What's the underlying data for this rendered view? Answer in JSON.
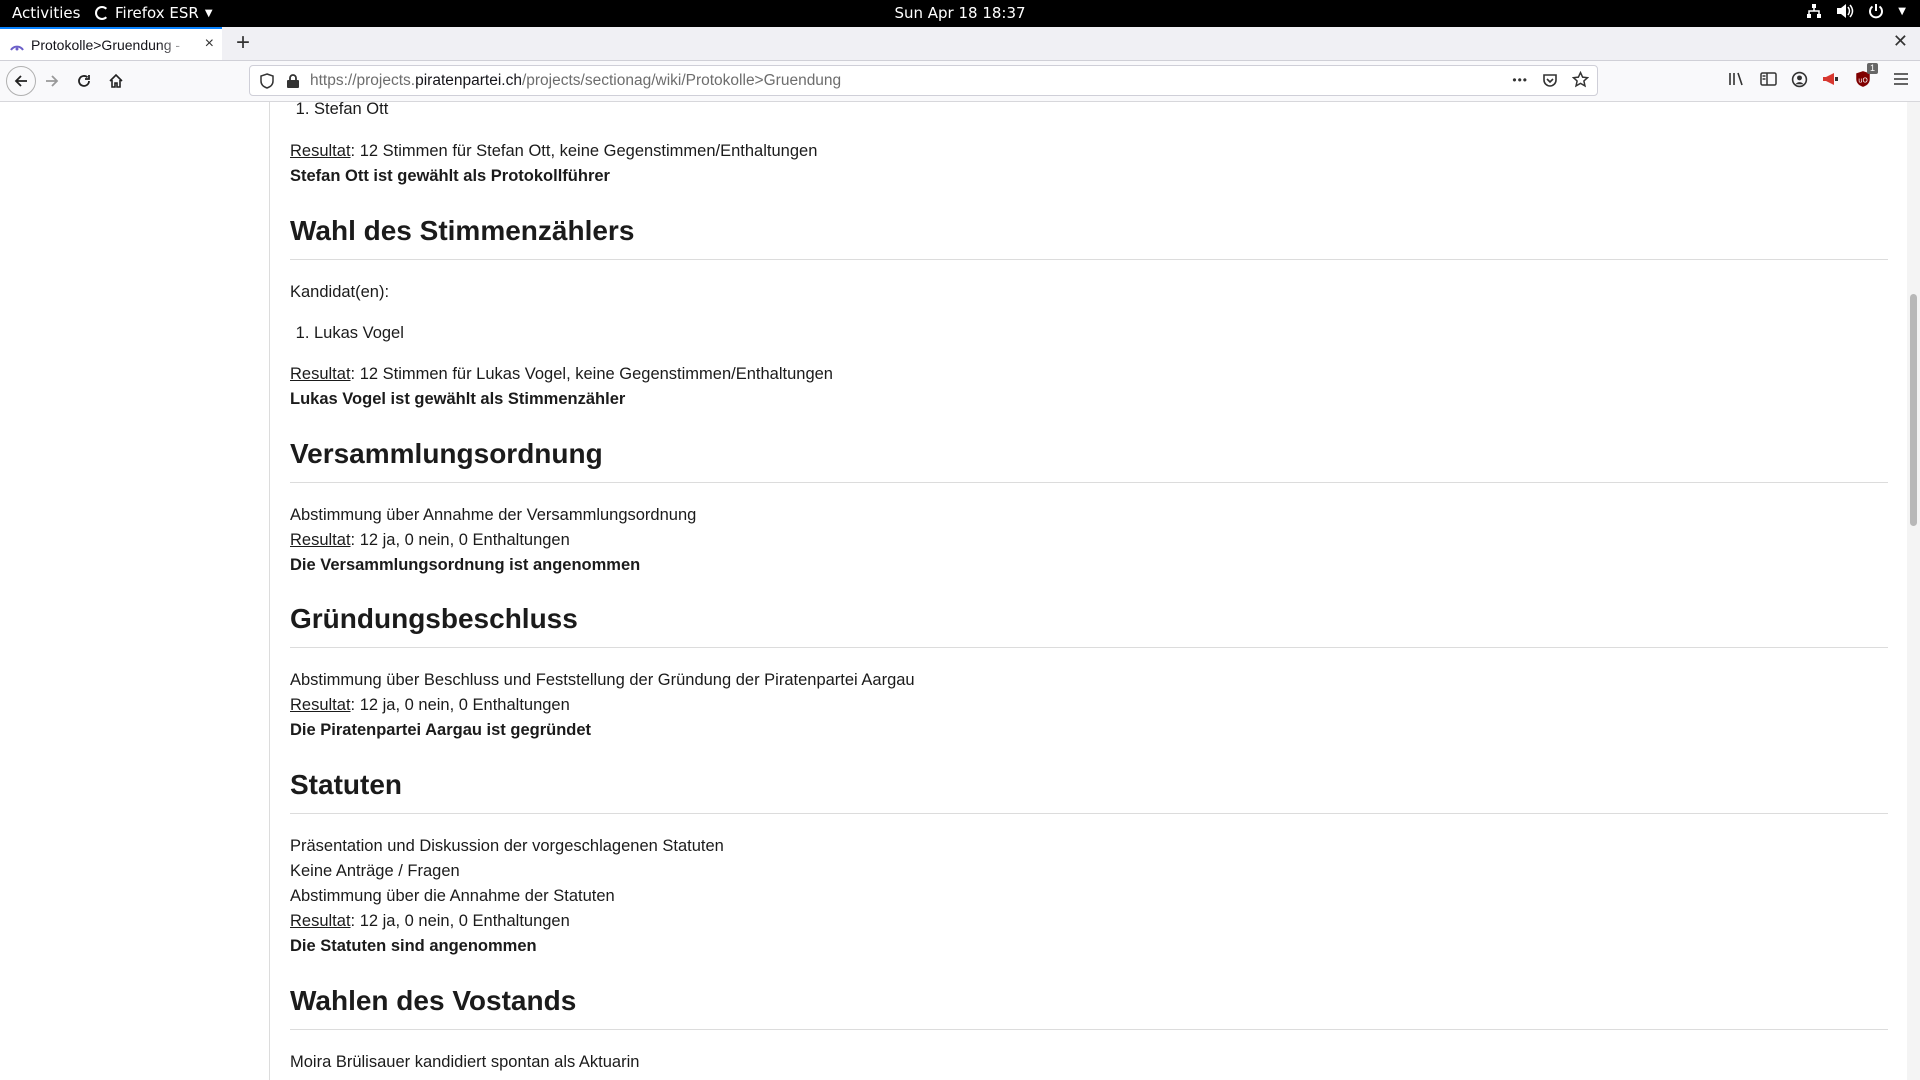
{
  "topbar": {
    "activities": "Activities",
    "app_name": "Firefox ESR",
    "clock": "Sun Apr 18  18:37"
  },
  "tab": {
    "title": "Protokolle>Gruendung - ",
    "close": "×"
  },
  "newtab": "+",
  "urlbar": {
    "prefix": "https://projects.",
    "host": "piratenpartei.ch",
    "path": "/projects/sectionag/wiki/Protokolle>Gruendung",
    "menu": "•••"
  },
  "badges": {
    "ublock_count": "1"
  },
  "content": {
    "candidate_1": "Stefan Ott",
    "result_label": "Resultat",
    "result_1": ": 12 Stimmen für Stefan Ott, keine Gegenstimmen/Enthaltungen",
    "elected_1": "Stefan Ott ist gewählt als Protokollführer",
    "h_stimmen": "Wahl des Stimmenzählers",
    "kandidaten": "Kandidat(en):",
    "candidate_2": "Lukas Vogel",
    "result_2": ": 12 Stimmen für Lukas Vogel, keine Gegenstimmen/Enthaltungen",
    "elected_2": "Lukas Vogel ist gewählt als Stimmenzähler",
    "h_versammlung": "Versammlungsordnung",
    "vote_versammlung": "Abstimmung über Annahme der Versammlungsordnung",
    "result_3": ": 12 ja, 0 nein, 0 Enthaltungen",
    "outcome_versammlung": "Die Versammlungsordnung ist angenommen",
    "h_gruendung": "Gründungsbeschluss",
    "vote_gruendung": "Abstimmung über Beschluss und Feststellung der Gründung der Piratenpartei Aargau",
    "result_4": ": 12 ja, 0 nein, 0 Enthaltungen",
    "outcome_gruendung": "Die Piratenpartei Aargau ist gegründet",
    "h_statuten": "Statuten",
    "statuten_1": "Präsentation und Diskussion der vorgeschlagenen Statuten",
    "statuten_2": "Keine Anträge / Fragen",
    "statuten_3": "Abstimmung über die Annahme der Statuten",
    "result_5": ": 12 ja, 0 nein, 0 Enthaltungen",
    "outcome_statuten": "Die Statuten sind angenommen",
    "h_vorstand": "Wahlen des Vostands",
    "vorstand_1": "Moira Brülisauer kandidiert spontan als Aktuarin"
  }
}
